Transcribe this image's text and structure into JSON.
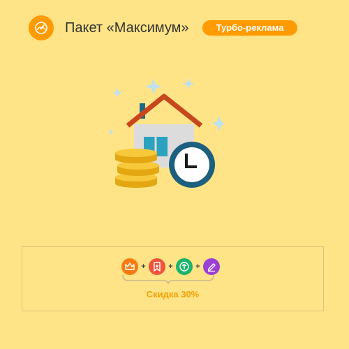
{
  "header": {
    "icon": "speedometer-icon",
    "title": "Пакет «Максимум»",
    "badge": "Турбо-реклама"
  },
  "illustration": {
    "icon": "house-coins-clock-icon"
  },
  "offer": {
    "services": [
      {
        "icon": "crown-icon",
        "color": "#f97a10"
      },
      {
        "icon": "bookmark-star-icon",
        "color": "#f0523a"
      },
      {
        "icon": "arrow-up-icon",
        "color": "#1eb36a"
      },
      {
        "icon": "pen-highlight-icon",
        "color": "#9b3fd6"
      }
    ],
    "plus": "+",
    "discount": "Скидка 30%"
  },
  "colors": {
    "background": "#ffe487",
    "accent": "#ff9a00"
  }
}
